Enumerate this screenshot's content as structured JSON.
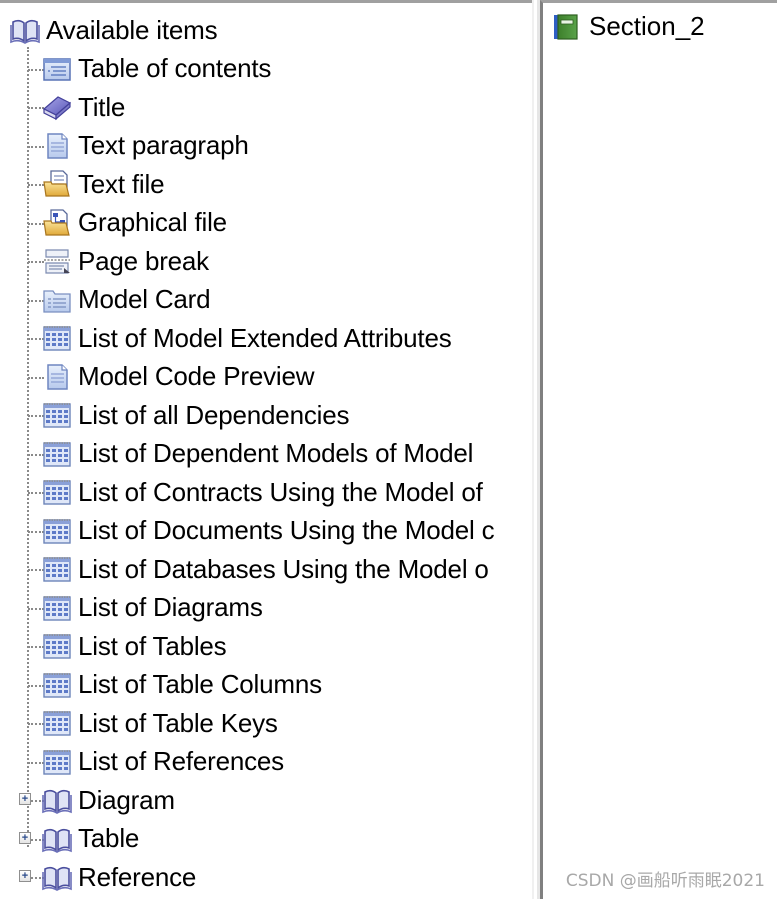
{
  "tree": {
    "root": {
      "label": "Available items",
      "icon": "open-book-icon"
    },
    "items": [
      {
        "label": "Table of contents",
        "icon": "table-of-contents-icon"
      },
      {
        "label": "Title",
        "icon": "title-book-icon"
      },
      {
        "label": "Text paragraph",
        "icon": "document-icon"
      },
      {
        "label": "Text file",
        "icon": "text-file-folder-icon"
      },
      {
        "label": "Graphical file",
        "icon": "graphical-file-folder-icon"
      },
      {
        "label": "Page break",
        "icon": "page-break-icon"
      },
      {
        "label": "Model Card",
        "icon": "card-folder-icon"
      },
      {
        "label": "List of Model Extended Attributes",
        "icon": "list-grid-icon"
      },
      {
        "label": "Model Code Preview",
        "icon": "document-icon"
      },
      {
        "label": "List of all Dependencies",
        "icon": "list-grid-icon"
      },
      {
        "label": "List of Dependent Models of Model",
        "icon": "list-grid-icon"
      },
      {
        "label": "List of Contracts Using the Model of",
        "icon": "list-grid-icon"
      },
      {
        "label": "List of Documents Using the Model c",
        "icon": "list-grid-icon"
      },
      {
        "label": "List of Databases Using the Model o",
        "icon": "list-grid-icon"
      },
      {
        "label": "List of Diagrams",
        "icon": "list-grid-icon"
      },
      {
        "label": "List of Tables",
        "icon": "list-grid-icon"
      },
      {
        "label": "List of Table Columns",
        "icon": "list-grid-icon"
      },
      {
        "label": "List of Table Keys",
        "icon": "list-grid-icon"
      },
      {
        "label": "List of References",
        "icon": "list-grid-icon"
      }
    ],
    "groups": [
      {
        "label": "Diagram",
        "icon": "open-book-icon",
        "expander": "+"
      },
      {
        "label": "Table",
        "icon": "open-book-icon",
        "expander": "+"
      },
      {
        "label": "Reference",
        "icon": "open-book-icon",
        "expander": "+"
      }
    ]
  },
  "right": {
    "section_label": "Section_2",
    "icon": "section-book-icon"
  },
  "watermark": "CSDN @画船听雨眠2021"
}
